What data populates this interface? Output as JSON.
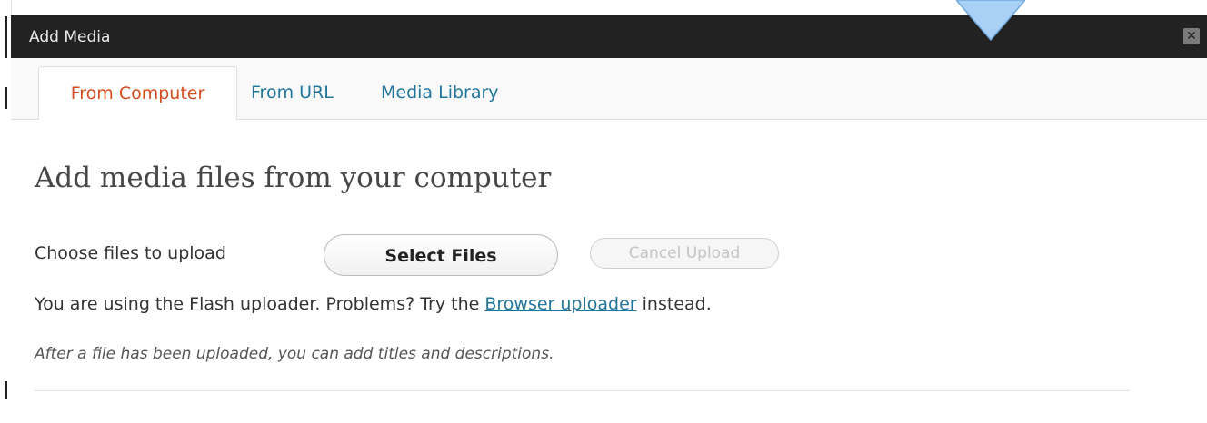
{
  "dialog": {
    "title": "Add Media",
    "close_glyph": "✕"
  },
  "tabs": [
    {
      "label": "From Computer",
      "active": true
    },
    {
      "label": "From URL",
      "active": false
    },
    {
      "label": "Media Library",
      "active": false
    }
  ],
  "main": {
    "heading": "Add media files from your computer",
    "choose_label": "Choose files to upload",
    "select_files_label": "Select Files",
    "cancel_upload_label": "Cancel Upload",
    "flash_prefix": "You are using the Flash uploader. Problems? Try the ",
    "browser_uploader_link": "Browser uploader",
    "flash_suffix": " instead.",
    "note": "After a file has been uploaded, you can add titles and descriptions."
  },
  "colors": {
    "titlebar_bg": "#222222",
    "active_tab": "#d54e21",
    "link": "#21759b",
    "pointer_fill": "#a9d0f5"
  },
  "icons": {
    "close": "close-icon",
    "pointer": "pointer-arrow-icon"
  }
}
